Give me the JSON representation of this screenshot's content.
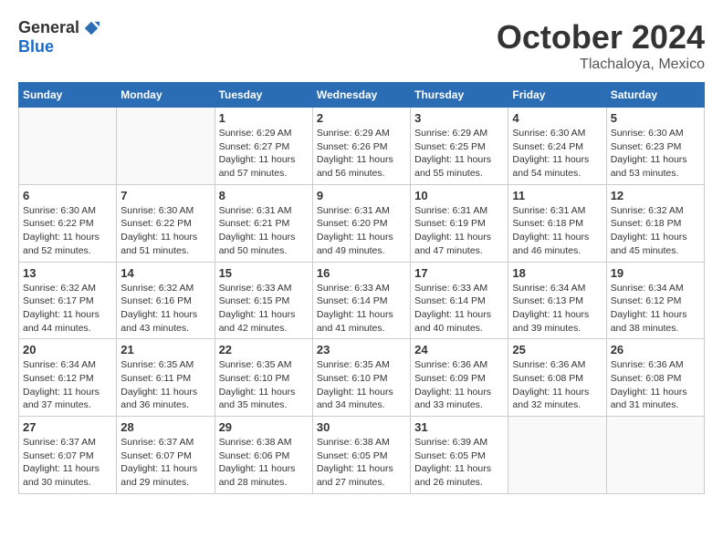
{
  "header": {
    "logo_general": "General",
    "logo_blue": "Blue",
    "month": "October 2024",
    "location": "Tlachaloya, Mexico"
  },
  "weekdays": [
    "Sunday",
    "Monday",
    "Tuesday",
    "Wednesday",
    "Thursday",
    "Friday",
    "Saturday"
  ],
  "weeks": [
    [
      {
        "day": "",
        "info": ""
      },
      {
        "day": "",
        "info": ""
      },
      {
        "day": "1",
        "info": "Sunrise: 6:29 AM\nSunset: 6:27 PM\nDaylight: 11 hours and 57 minutes."
      },
      {
        "day": "2",
        "info": "Sunrise: 6:29 AM\nSunset: 6:26 PM\nDaylight: 11 hours and 56 minutes."
      },
      {
        "day": "3",
        "info": "Sunrise: 6:29 AM\nSunset: 6:25 PM\nDaylight: 11 hours and 55 minutes."
      },
      {
        "day": "4",
        "info": "Sunrise: 6:30 AM\nSunset: 6:24 PM\nDaylight: 11 hours and 54 minutes."
      },
      {
        "day": "5",
        "info": "Sunrise: 6:30 AM\nSunset: 6:23 PM\nDaylight: 11 hours and 53 minutes."
      }
    ],
    [
      {
        "day": "6",
        "info": "Sunrise: 6:30 AM\nSunset: 6:22 PM\nDaylight: 11 hours and 52 minutes."
      },
      {
        "day": "7",
        "info": "Sunrise: 6:30 AM\nSunset: 6:22 PM\nDaylight: 11 hours and 51 minutes."
      },
      {
        "day": "8",
        "info": "Sunrise: 6:31 AM\nSunset: 6:21 PM\nDaylight: 11 hours and 50 minutes."
      },
      {
        "day": "9",
        "info": "Sunrise: 6:31 AM\nSunset: 6:20 PM\nDaylight: 11 hours and 49 minutes."
      },
      {
        "day": "10",
        "info": "Sunrise: 6:31 AM\nSunset: 6:19 PM\nDaylight: 11 hours and 47 minutes."
      },
      {
        "day": "11",
        "info": "Sunrise: 6:31 AM\nSunset: 6:18 PM\nDaylight: 11 hours and 46 minutes."
      },
      {
        "day": "12",
        "info": "Sunrise: 6:32 AM\nSunset: 6:18 PM\nDaylight: 11 hours and 45 minutes."
      }
    ],
    [
      {
        "day": "13",
        "info": "Sunrise: 6:32 AM\nSunset: 6:17 PM\nDaylight: 11 hours and 44 minutes."
      },
      {
        "day": "14",
        "info": "Sunrise: 6:32 AM\nSunset: 6:16 PM\nDaylight: 11 hours and 43 minutes."
      },
      {
        "day": "15",
        "info": "Sunrise: 6:33 AM\nSunset: 6:15 PM\nDaylight: 11 hours and 42 minutes."
      },
      {
        "day": "16",
        "info": "Sunrise: 6:33 AM\nSunset: 6:14 PM\nDaylight: 11 hours and 41 minutes."
      },
      {
        "day": "17",
        "info": "Sunrise: 6:33 AM\nSunset: 6:14 PM\nDaylight: 11 hours and 40 minutes."
      },
      {
        "day": "18",
        "info": "Sunrise: 6:34 AM\nSunset: 6:13 PM\nDaylight: 11 hours and 39 minutes."
      },
      {
        "day": "19",
        "info": "Sunrise: 6:34 AM\nSunset: 6:12 PM\nDaylight: 11 hours and 38 minutes."
      }
    ],
    [
      {
        "day": "20",
        "info": "Sunrise: 6:34 AM\nSunset: 6:12 PM\nDaylight: 11 hours and 37 minutes."
      },
      {
        "day": "21",
        "info": "Sunrise: 6:35 AM\nSunset: 6:11 PM\nDaylight: 11 hours and 36 minutes."
      },
      {
        "day": "22",
        "info": "Sunrise: 6:35 AM\nSunset: 6:10 PM\nDaylight: 11 hours and 35 minutes."
      },
      {
        "day": "23",
        "info": "Sunrise: 6:35 AM\nSunset: 6:10 PM\nDaylight: 11 hours and 34 minutes."
      },
      {
        "day": "24",
        "info": "Sunrise: 6:36 AM\nSunset: 6:09 PM\nDaylight: 11 hours and 33 minutes."
      },
      {
        "day": "25",
        "info": "Sunrise: 6:36 AM\nSunset: 6:08 PM\nDaylight: 11 hours and 32 minutes."
      },
      {
        "day": "26",
        "info": "Sunrise: 6:36 AM\nSunset: 6:08 PM\nDaylight: 11 hours and 31 minutes."
      }
    ],
    [
      {
        "day": "27",
        "info": "Sunrise: 6:37 AM\nSunset: 6:07 PM\nDaylight: 11 hours and 30 minutes."
      },
      {
        "day": "28",
        "info": "Sunrise: 6:37 AM\nSunset: 6:07 PM\nDaylight: 11 hours and 29 minutes."
      },
      {
        "day": "29",
        "info": "Sunrise: 6:38 AM\nSunset: 6:06 PM\nDaylight: 11 hours and 28 minutes."
      },
      {
        "day": "30",
        "info": "Sunrise: 6:38 AM\nSunset: 6:05 PM\nDaylight: 11 hours and 27 minutes."
      },
      {
        "day": "31",
        "info": "Sunrise: 6:39 AM\nSunset: 6:05 PM\nDaylight: 11 hours and 26 minutes."
      },
      {
        "day": "",
        "info": ""
      },
      {
        "day": "",
        "info": ""
      }
    ]
  ]
}
